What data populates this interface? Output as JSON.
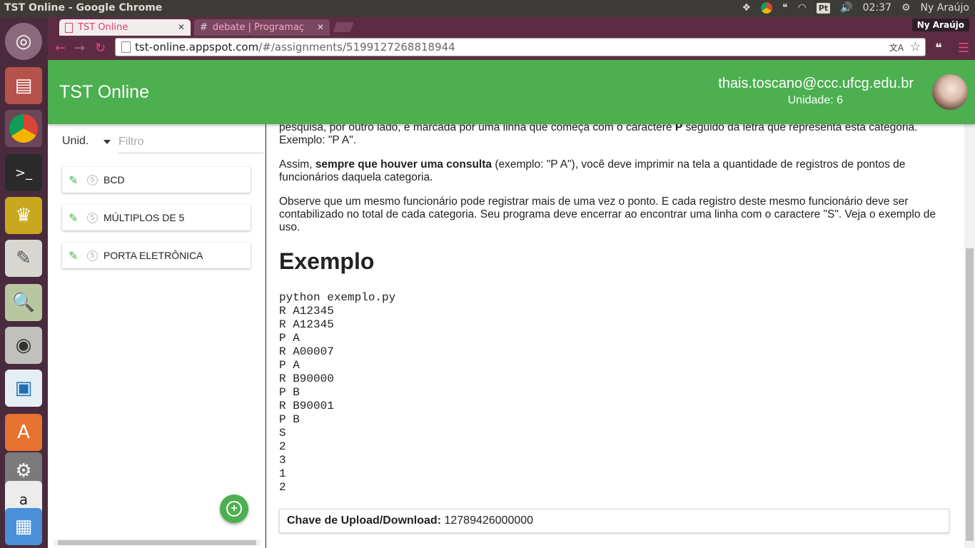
{
  "os": {
    "window_title": "TST Online - Google Chrome",
    "keyboard_layout": "Pt",
    "time": "02:37",
    "user": "Ny Araújo"
  },
  "browser": {
    "tabs": [
      {
        "label": "TST Online",
        "active": true
      },
      {
        "label": "debate | Programaç",
        "active": false
      }
    ],
    "profile_name": "Ny Araújo",
    "url_host": "tst-online.appspot.com",
    "url_rest": "/#/assignments/5199127268818944"
  },
  "app": {
    "title": "TST Online",
    "user_email": "thais.toscano@ccc.ufcg.edu.br",
    "unit_label": "Unidade: 6"
  },
  "sidebar": {
    "unit_select": "Unid.",
    "filter_placeholder": "Filtro",
    "items": [
      {
        "badge": "5",
        "label": "BCD"
      },
      {
        "badge": "5",
        "label": "MÚLTIPLOS DE 5"
      },
      {
        "badge": "5",
        "label": "PORTA ELETRÔNICA"
      }
    ]
  },
  "content": {
    "para1_line1": "pesquisa, por outro lado, é marcada por uma linha que começa com o caractere ",
    "para1_bold": "P",
    "para1_line1b": " seguido da letra que representa esta categoria.",
    "para1_line2": "Exemplo: \"P A\".",
    "para2_pre": "Assim, ",
    "para2_bold": "sempre que houver uma consulta",
    "para2_post": " (exemplo: \"P A\"), você deve imprimir na tela a quantidade de registros de pontos de funcionários daquela categoria.",
    "para3": "Observe que um mesmo funcionário pode registrar mais de uma vez o ponto. E cada registro deste mesmo funcionário deve ser contabilizado no total de cada categoria. Seu programa deve encerrar ao encontrar uma linha com o caractere \"S\". Veja o exemplo de uso.",
    "example_heading": "Exemplo",
    "example_code": "python exemplo.py\nR A12345\nR A12345\nP A\nR A00007\nP A\nR B90000\nP B\nR B90001\nP B\nS\n2\n3\n1\n2",
    "key_label": "Chave de Upload/Download:",
    "key_value": "12789426000000"
  }
}
